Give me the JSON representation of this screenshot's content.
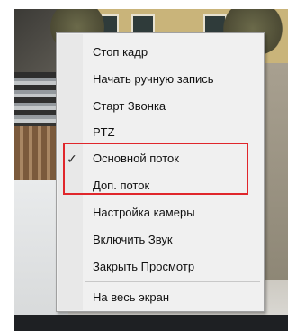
{
  "context_menu": {
    "items": [
      {
        "label": "Стоп кадр",
        "checked": false
      },
      {
        "label": "Начать ручную запись",
        "checked": false
      },
      {
        "label": "Старт Звонка",
        "checked": false
      },
      {
        "label": "PTZ",
        "checked": false
      },
      {
        "label": "Основной поток",
        "checked": true,
        "check_mark": "✓"
      },
      {
        "label": "Доп. поток",
        "checked": false
      },
      {
        "label": "Настройка камеры",
        "checked": false
      },
      {
        "label": "Включить Звук",
        "checked": false
      },
      {
        "label": "Закрыть Просмотр",
        "checked": false
      },
      {
        "label": "На весь экран",
        "checked": false
      }
    ]
  },
  "colors": {
    "highlight_border": "#e0262b",
    "menu_background": "#f0f0f0"
  }
}
